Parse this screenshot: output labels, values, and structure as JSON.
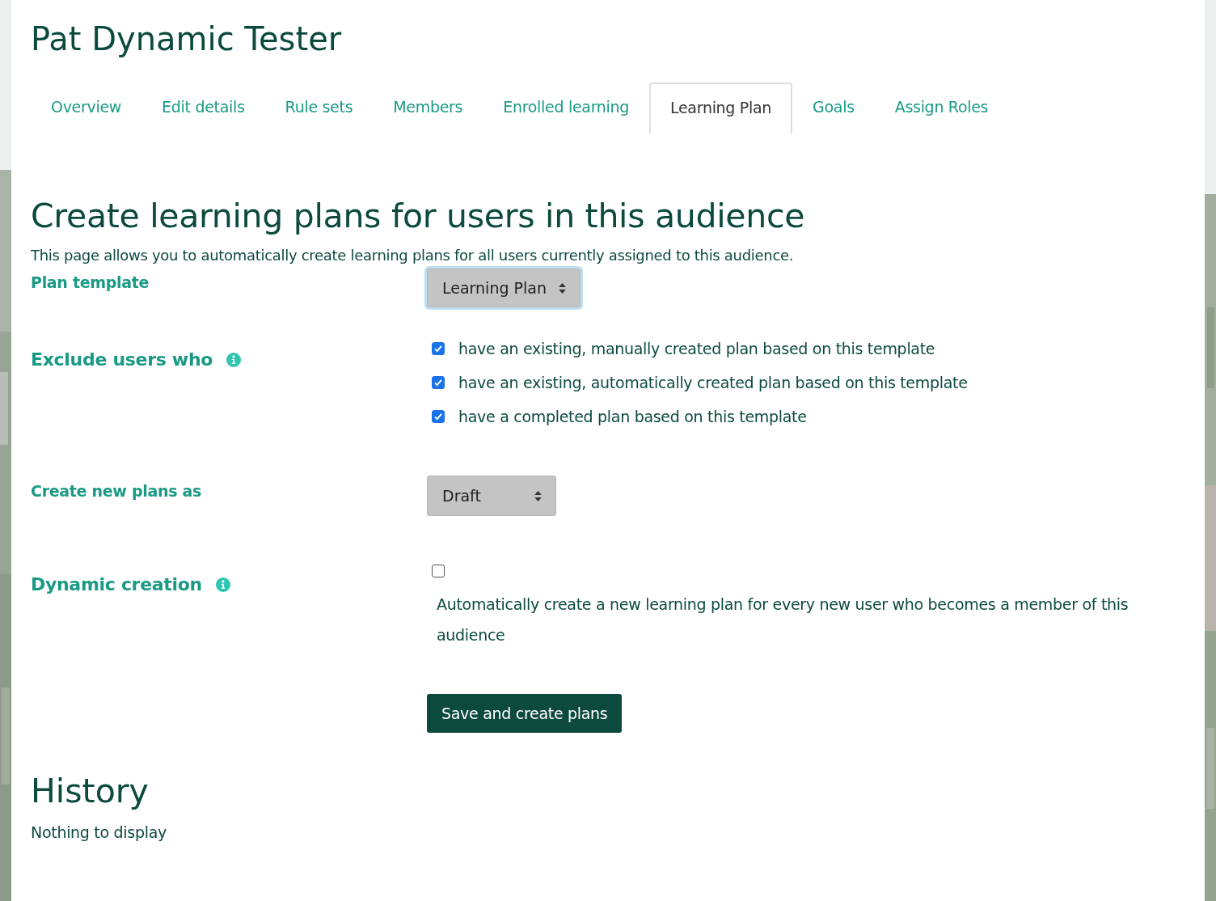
{
  "page_title": "Pat Dynamic Tester",
  "tabs": [
    {
      "label": "Overview",
      "selected": false
    },
    {
      "label": "Edit details",
      "selected": false
    },
    {
      "label": "Rule sets",
      "selected": false
    },
    {
      "label": "Members",
      "selected": false
    },
    {
      "label": "Enrolled learning",
      "selected": false
    },
    {
      "label": "Learning Plan",
      "selected": true
    },
    {
      "label": "Goals",
      "selected": false
    },
    {
      "label": "Assign Roles",
      "selected": false
    }
  ],
  "heading": "Create learning plans for users in this audience",
  "description": "This page allows you to automatically create learning plans for all users currently assigned to this audience.",
  "plan_template": {
    "label": "Plan template",
    "value": "Learning Plan",
    "focused": true
  },
  "exclude": {
    "label": "Exclude users who",
    "options": [
      {
        "label": "have an existing, manually created plan based on this template",
        "checked": true
      },
      {
        "label": "have an existing, automatically created plan based on this template",
        "checked": true
      },
      {
        "label": "have a completed plan based on this template",
        "checked": true
      }
    ]
  },
  "create_as": {
    "label": "Create new plans as",
    "value": "Draft",
    "focused": false
  },
  "dynamic": {
    "label": "Dynamic creation",
    "checked": false,
    "description": "Automatically create a new learning plan for every new user who becomes a member of this audience"
  },
  "submit_label": "Save and create plans",
  "history": {
    "heading": "History",
    "empty_text": "Nothing to display"
  }
}
